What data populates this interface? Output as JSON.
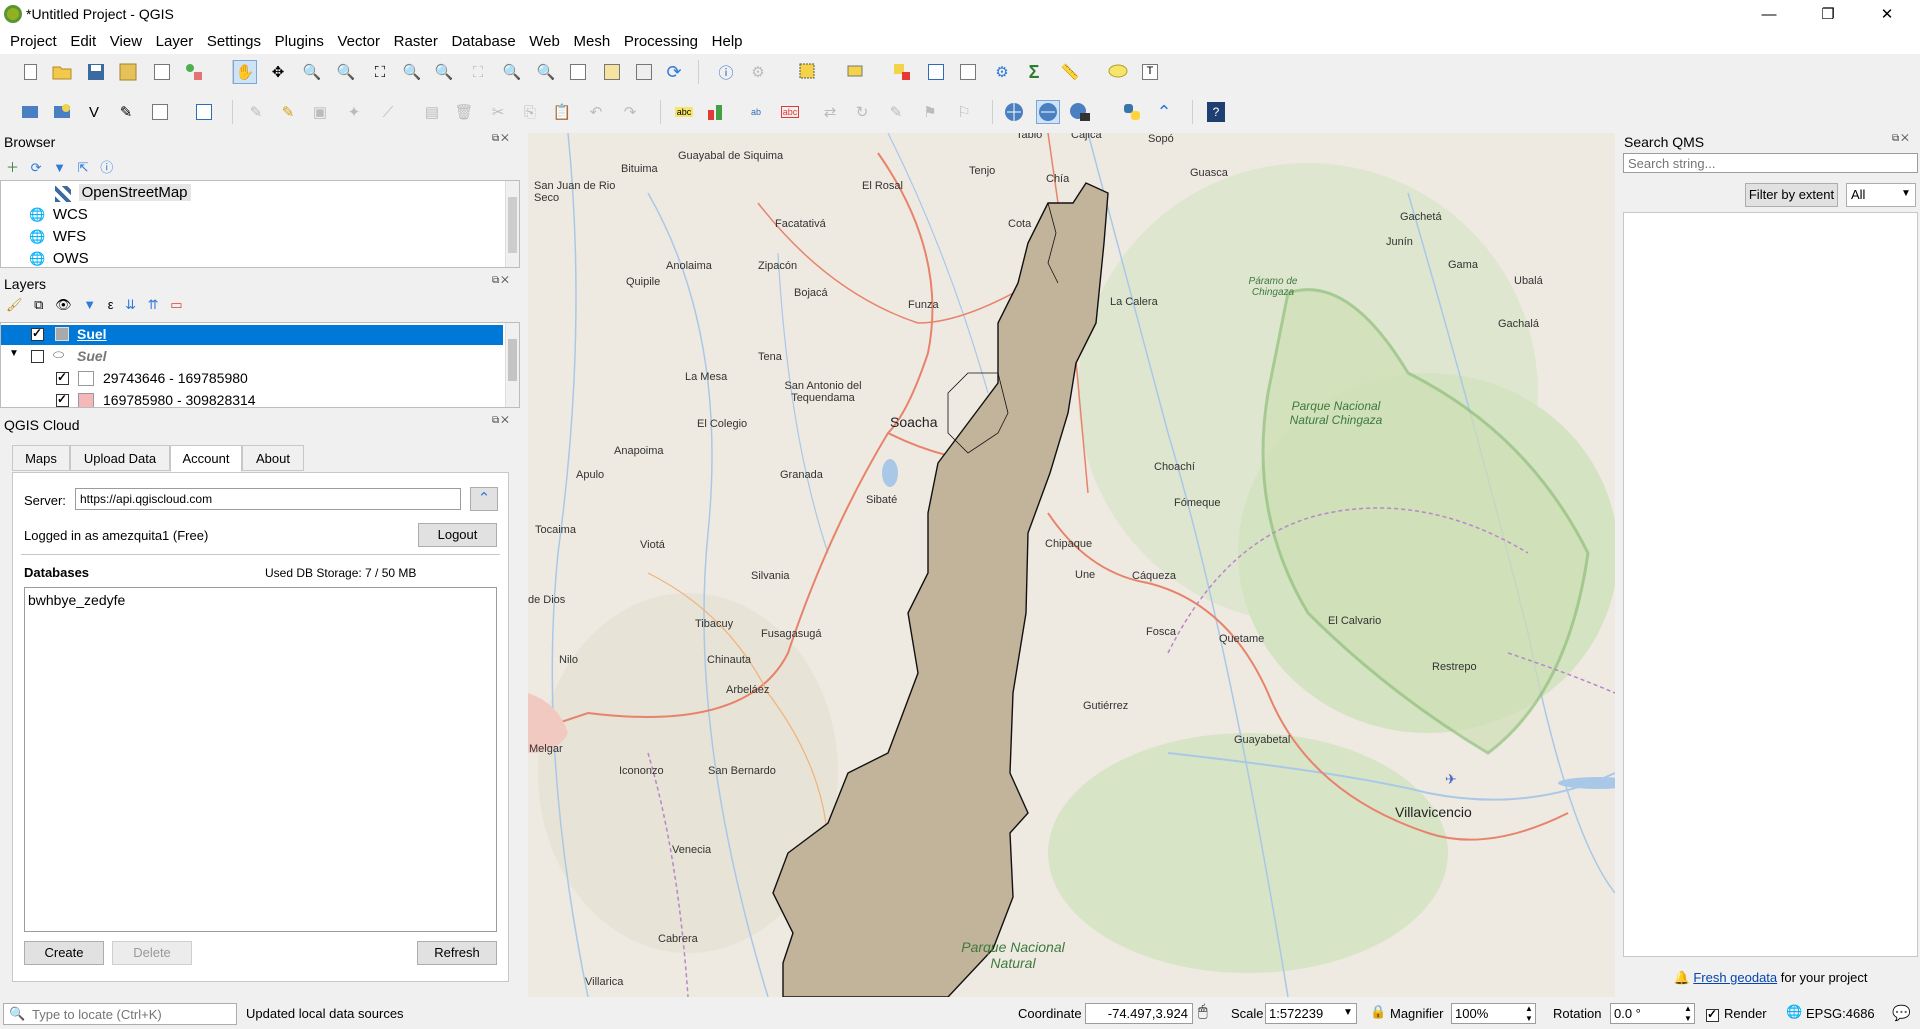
{
  "window": {
    "title": "*Untitled Project - QGIS",
    "minimize": "—",
    "restore": "❐",
    "close": "✕"
  },
  "menu": [
    "Project",
    "Edit",
    "View",
    "Layer",
    "Settings",
    "Plugins",
    "Vector",
    "Raster",
    "Database",
    "Web",
    "Mesh",
    "Processing",
    "Help"
  ],
  "browser": {
    "title": "Browser",
    "items": [
      "OpenStreetMap",
      "WCS",
      "WFS",
      "OWS"
    ]
  },
  "layers": {
    "title": "Layers",
    "items": [
      {
        "label": "Suel",
        "checked": true,
        "selected": true
      },
      {
        "label": "Suel",
        "checked": false,
        "group": true
      },
      {
        "label": "29743646 - 169785980",
        "checked": true,
        "swatch": "#ffffff"
      },
      {
        "label": "169785980 - 309828314",
        "checked": true,
        "swatch": "#f4b8b8"
      }
    ]
  },
  "cloud": {
    "title": "QGIS Cloud",
    "tabs": [
      "Maps",
      "Upload Data",
      "Account",
      "About"
    ],
    "server_label": "Server:",
    "server_value": "https://api.qgiscloud.com",
    "logged_in": "Logged in as amezquita1 (Free)",
    "logout": "Logout",
    "databases_label": "Databases",
    "storage": "Used DB Storage: 7 / 50 MB",
    "databases": [
      "bwhbye_zedyfe"
    ],
    "create": "Create",
    "delete": "Delete",
    "refresh": "Refresh"
  },
  "qms": {
    "title": "Search QMS",
    "search_placeholder": "Search string...",
    "filter_button": "Filter by extent",
    "filter_select": "All",
    "fresh_link": "Fresh geodata",
    "fresh_suffix": " for your project"
  },
  "map": {
    "labels": [
      "Guayabal de Siquima",
      "Bituima",
      "El Rosal",
      "Tenjo",
      "Chía",
      "Sopó",
      "Guasca",
      "Tabio",
      "Cajicá",
      "Cota",
      "San Juan de Rio Seco",
      "Facatativá",
      "Gachetá",
      "Junín",
      "Gama",
      "Ubalá",
      "Gachalá",
      "Anolaima",
      "Zipacón",
      "Quipile",
      "Bojacá",
      "Funza",
      "La Calera",
      "Páramo de Chingaza",
      "Tena",
      "La Mesa",
      "San Antonio del Tequendama",
      "Soacha",
      "El Colegio",
      "Anapoima",
      "Apulo",
      "Granada",
      "Sibaté",
      "Choachí",
      "Fómeque",
      "Parque Nacional Natural Chingaza",
      "Tocaima",
      "Viotá",
      "Chipaque",
      "Une",
      "Cáqueza",
      "de Dios",
      "Silvania",
      "Tibacuy",
      "Fusagasugá",
      "Fosca",
      "Quetame",
      "El Calvario",
      "Nilo",
      "Chinauta",
      "Arbeláez",
      "Gutiérrez",
      "Restrepo",
      "Melgar",
      "Icononzo",
      "San Bernardo",
      "Guayabetal",
      "Villavicencio",
      "Venecia",
      "Cabrera",
      "Villarica",
      "Parque Nacional Natural"
    ]
  },
  "status": {
    "locate_placeholder": "Type to locate (Ctrl+K)",
    "message": "Updated local data sources",
    "coordinate_label": "Coordinate",
    "coordinate_value": "-74.497,3.924",
    "scale_label": "Scale",
    "scale_value": "1:572239",
    "magnifier_label": "Magnifier",
    "magnifier_value": "100%",
    "rotation_label": "Rotation",
    "rotation_value": "0.0 °",
    "render_label": "Render",
    "crs": "EPSG:4686"
  }
}
